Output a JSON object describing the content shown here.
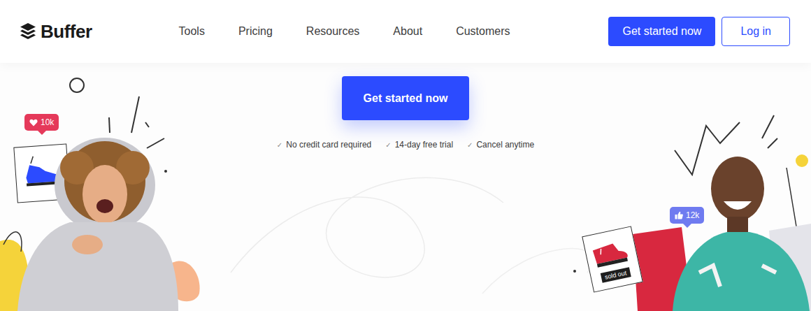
{
  "logo": {
    "text": "Buffer"
  },
  "nav": {
    "links": [
      "Tools",
      "Pricing",
      "Resources",
      "About",
      "Customers"
    ]
  },
  "header_buttons": {
    "primary": "Get started now",
    "secondary": "Log in"
  },
  "hero": {
    "cta": "Get started now",
    "features": [
      {
        "check": "✓",
        "label": "No credit card required"
      },
      {
        "check": "✓",
        "label": "14-day free trial"
      },
      {
        "check": "✓",
        "label": "Cancel anytime"
      }
    ]
  },
  "illustrations": {
    "left_badge": {
      "count": "10k"
    },
    "right_badge": {
      "count": "12k"
    },
    "sold_out_card": {
      "label": "sold out"
    }
  }
}
